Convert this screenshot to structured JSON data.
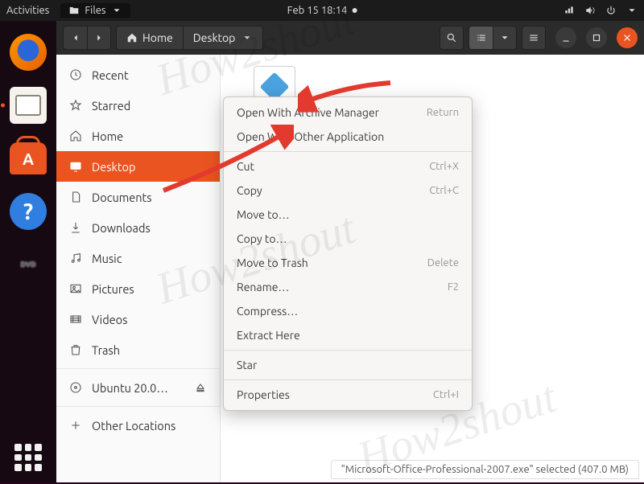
{
  "panel": {
    "activities": "Activities",
    "app_menu": "Files",
    "clock": "Feb 15  18:14"
  },
  "dock": {
    "dvd_label": "DVD"
  },
  "titlebar": {
    "path_home": "Home",
    "path_current": "Desktop"
  },
  "sidebar": {
    "items": [
      {
        "label": "Recent"
      },
      {
        "label": "Starred"
      },
      {
        "label": "Home"
      },
      {
        "label": "Desktop"
      },
      {
        "label": "Documents"
      },
      {
        "label": "Downloads"
      },
      {
        "label": "Music"
      },
      {
        "label": "Pictures"
      },
      {
        "label": "Videos"
      },
      {
        "label": "Trash"
      },
      {
        "label": "Ubuntu 20.0…"
      },
      {
        "label": "Other Locations"
      }
    ]
  },
  "file": {
    "display_name": "Microsoft-Office-Professional-2007"
  },
  "context_menu": {
    "items": [
      {
        "label": "Open With Archive Manager",
        "accel": "Return"
      },
      {
        "label": "Open With Other Application",
        "accel": ""
      },
      {
        "sep": true
      },
      {
        "label": "Cut",
        "accel": "Ctrl+X"
      },
      {
        "label": "Copy",
        "accel": "Ctrl+C"
      },
      {
        "label": "Move to…",
        "accel": ""
      },
      {
        "label": "Copy to…",
        "accel": ""
      },
      {
        "label": "Move to Trash",
        "accel": "Delete"
      },
      {
        "label": "Rename…",
        "accel": "F2"
      },
      {
        "label": "Compress…",
        "accel": ""
      },
      {
        "label": "Extract Here",
        "accel": ""
      },
      {
        "sep": true
      },
      {
        "label": "Star",
        "accel": ""
      },
      {
        "sep": true
      },
      {
        "label": "Properties",
        "accel": "Ctrl+I"
      }
    ]
  },
  "statusbar": {
    "text": "\"Microsoft-Office-Professional-2007.exe\" selected  (407.0 MB)"
  },
  "watermarks": [
    "How2shout",
    "How2shout",
    "How2shout"
  ]
}
